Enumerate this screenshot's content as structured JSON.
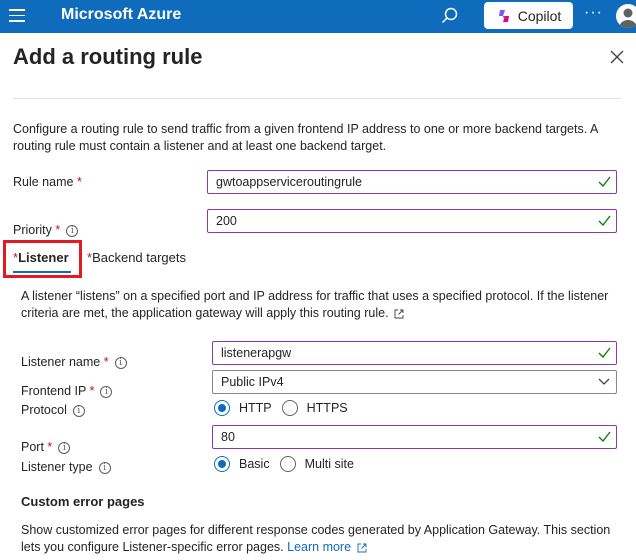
{
  "app": {
    "title": "Microsoft Azure",
    "copilot_label": "Copilot",
    "more": "···"
  },
  "panel": {
    "title": "Add a routing rule",
    "description": "Configure a routing rule to send traffic from a given frontend IP address to one or more backend targets. A routing rule must contain a listener and at least one backend target."
  },
  "rule": {
    "name_label": "Rule name",
    "name_value": "gwtoappserviceroutingrule",
    "priority_label": "Priority",
    "priority_value": "200"
  },
  "tabs": [
    {
      "label": "Listener",
      "active": true
    },
    {
      "label": "Backend targets",
      "active": false
    }
  ],
  "listener": {
    "description": "A listener “listens” on a specified port and IP address for traffic that uses a specified protocol. If the listener criteria are met, the application gateway will apply this routing rule.",
    "name_label": "Listener name",
    "name_value": "listenerapgw",
    "frontend_ip_label": "Frontend IP",
    "frontend_ip_value": "Public IPv4",
    "protocol_label": "Protocol",
    "protocol_options": [
      "HTTP",
      "HTTPS"
    ],
    "protocol_selected": "HTTP",
    "port_label": "Port",
    "port_value": "80",
    "listener_type_label": "Listener type",
    "listener_type_options": [
      "Basic",
      "Multi site"
    ],
    "listener_type_selected": "Basic"
  },
  "custom_error": {
    "heading": "Custom error pages",
    "description": "Show customized error pages for different response codes generated by Application Gateway. This section lets you configure Listener-specific error pages.",
    "learn_more": "Learn more"
  },
  "colors": {
    "brand": "#0f6cbd",
    "required": "#c50f1f",
    "valid": "#107c10",
    "field_border": "#8a3aa8",
    "highlight": "#e01b24"
  }
}
